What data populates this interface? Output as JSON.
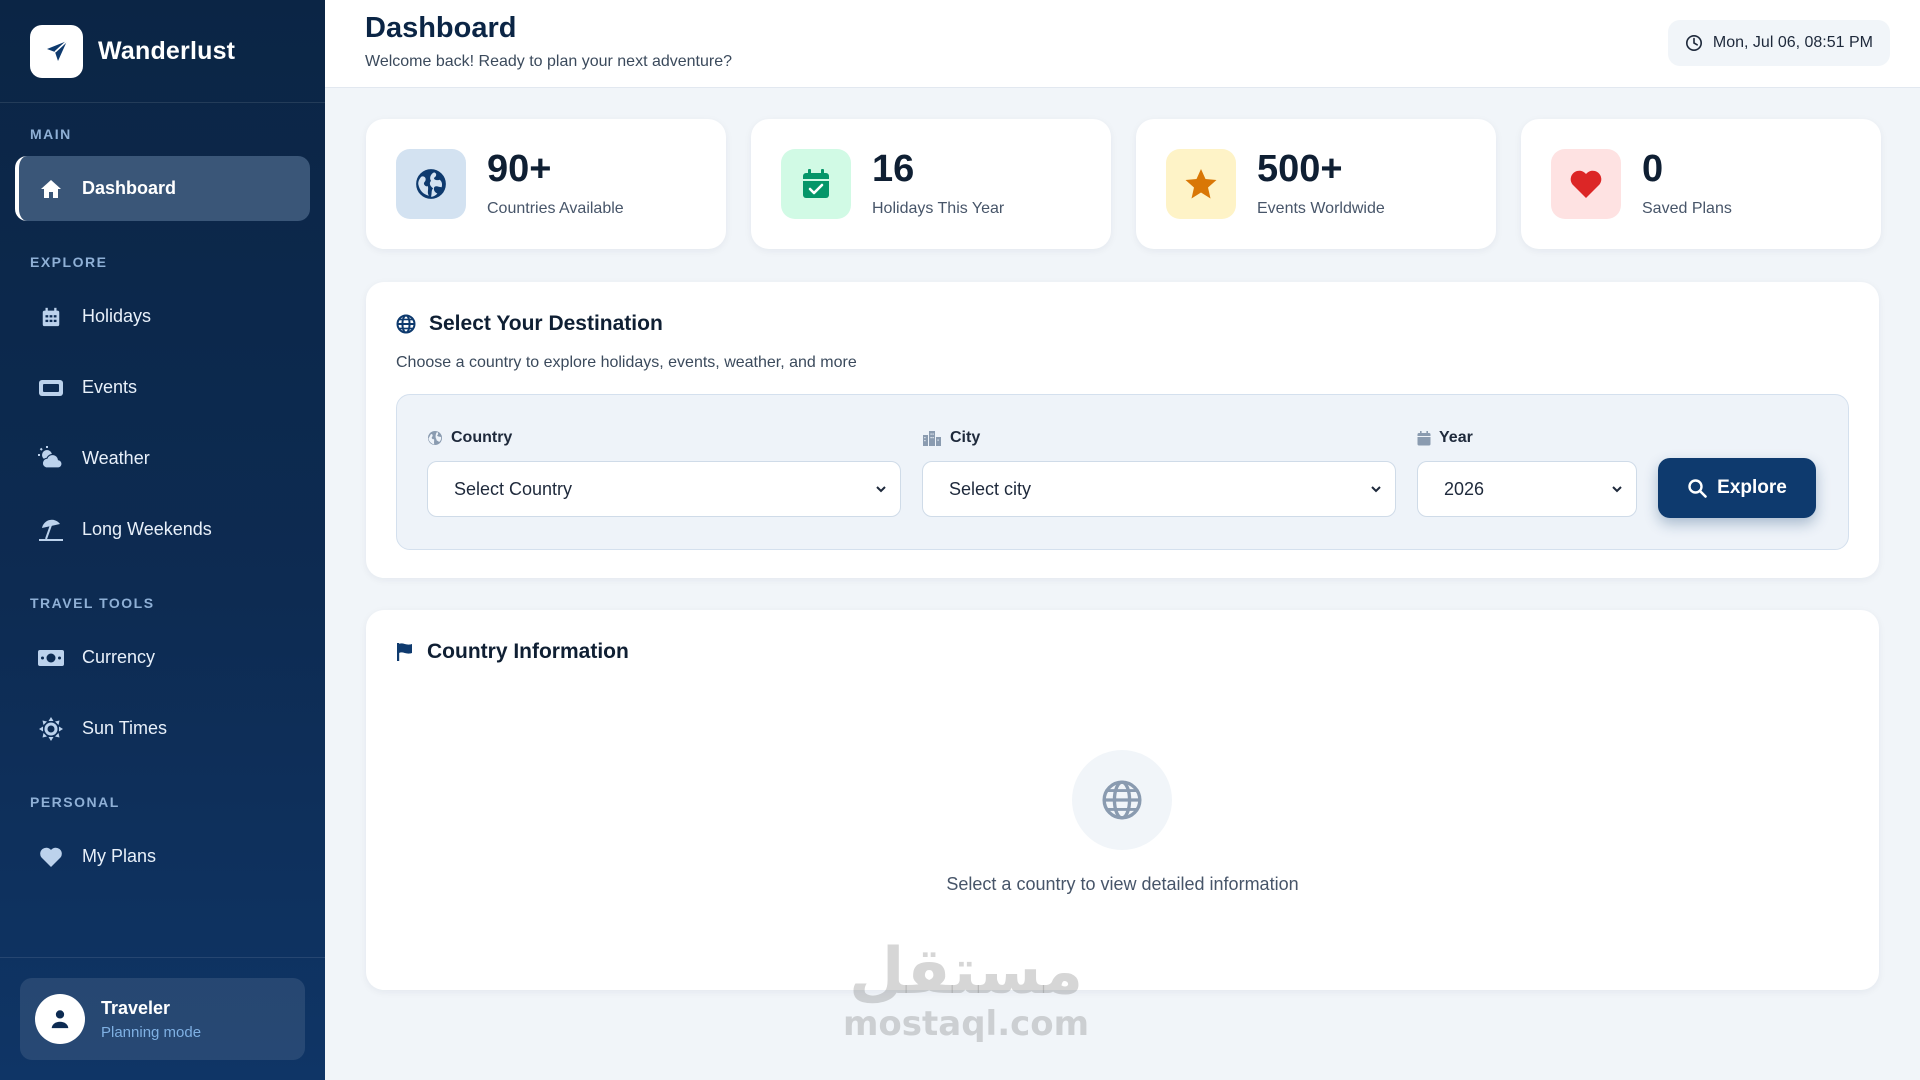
{
  "brand": {
    "name": "Wanderlust",
    "logo_icon": "paper-plane-icon"
  },
  "sidebar": {
    "sections": {
      "main": "MAIN",
      "explore": "EXPLORE",
      "tools": "TRAVEL TOOLS",
      "personal": "PERSONAL"
    },
    "items": [
      {
        "label": "Dashboard",
        "icon": "home-icon",
        "active": true
      },
      {
        "label": "Holidays",
        "icon": "calendar-icon"
      },
      {
        "label": "Events",
        "icon": "ticket-icon"
      },
      {
        "label": "Weather",
        "icon": "cloud-sun-icon"
      },
      {
        "label": "Long Weekends",
        "icon": "umbrella-beach-icon"
      },
      {
        "label": "Currency",
        "icon": "money-icon"
      },
      {
        "label": "Sun Times",
        "icon": "sun-icon"
      },
      {
        "label": "My Plans",
        "icon": "heart-icon"
      }
    ],
    "user": {
      "name": "Traveler",
      "mode": "Planning mode"
    }
  },
  "header": {
    "title": "Dashboard",
    "subtitle": "Welcome back! Ready to plan your next adventure?",
    "datetime": "Mon, Jul 06, 08:51 PM"
  },
  "stats": [
    {
      "value": "90+",
      "label": "Countries Available",
      "icon": "globe-icon",
      "color": "#0e3a6e",
      "bg": "#d3e2f1"
    },
    {
      "value": "16",
      "label": "Holidays This Year",
      "icon": "calendar-check-icon",
      "color": "#059669",
      "bg": "#d1fae5"
    },
    {
      "value": "500+",
      "label": "Events Worldwide",
      "icon": "star-icon",
      "color": "#d97706",
      "bg": "#fef3c7"
    },
    {
      "value": "0",
      "label": "Saved Plans",
      "icon": "heart-icon",
      "color": "#dc2626",
      "bg": "#fee2e2"
    }
  ],
  "destination": {
    "title": "Select Your Destination",
    "subtitle": "Choose a country to explore holidays, events, weather, and more",
    "country_label": "Country",
    "country_value": "Select Country",
    "city_label": "City",
    "city_value": "Select city",
    "year_label": "Year",
    "year_value": "2026",
    "explore_label": "Explore"
  },
  "country_info": {
    "title": "Country Information",
    "empty_text": "Select a country to view detailed information"
  },
  "watermark": {
    "arabic": "مستقل",
    "latin": "mostaql.com"
  },
  "colors": {
    "primary": "#0e3a6e",
    "sidebar": "#0b2545"
  }
}
